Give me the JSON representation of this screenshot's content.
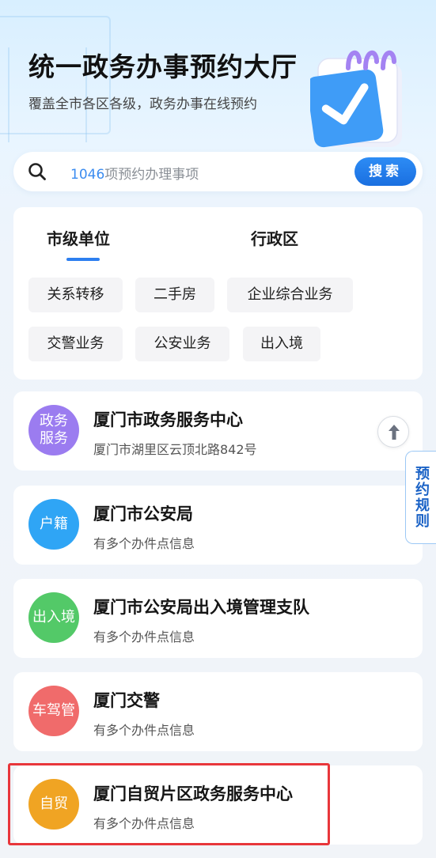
{
  "header": {
    "title": "统一政务办事预约大厅",
    "subtitle": "覆盖全市各区各级，政务办事在线预约"
  },
  "search": {
    "count": "1046",
    "placeholder_suffix": "项预约办理事项",
    "button_label": "搜索"
  },
  "tabs": [
    {
      "label": "市级单位",
      "active": true
    },
    {
      "label": "行政区",
      "active": false
    }
  ],
  "chips": [
    "关系转移",
    "二手房",
    "企业综合业务",
    "交警业务",
    "公安业务",
    "出入境"
  ],
  "units": [
    {
      "avatar": "政务\n服务",
      "avatar_color": "#9b7cf0",
      "name": "厦门市政务服务中心",
      "sub": "厦门市湖里区云顶北路842号"
    },
    {
      "avatar": "户籍",
      "avatar_color": "#2fa5f5",
      "name": "厦门市公安局",
      "sub": "有多个办件点信息"
    },
    {
      "avatar": "出入境",
      "avatar_color": "#53c968",
      "name": "厦门市公安局出入境管理支队",
      "sub": "有多个办件点信息"
    },
    {
      "avatar": "车驾管",
      "avatar_color": "#f06b6b",
      "name": "厦门交警",
      "sub": "有多个办件点信息"
    },
    {
      "avatar": "自贸",
      "avatar_color": "#f0a423",
      "name": "厦门自贸片区政务服务中心",
      "sub": "有多个办件点信息"
    }
  ],
  "side": {
    "rules_label": "预约规则"
  },
  "icons": {
    "search": "search-icon",
    "back_to_top": "arrow-up-icon",
    "hero": "calendar-check-icon"
  },
  "colors": {
    "accent": "#2d7ff0",
    "highlight": "#e8363b"
  }
}
